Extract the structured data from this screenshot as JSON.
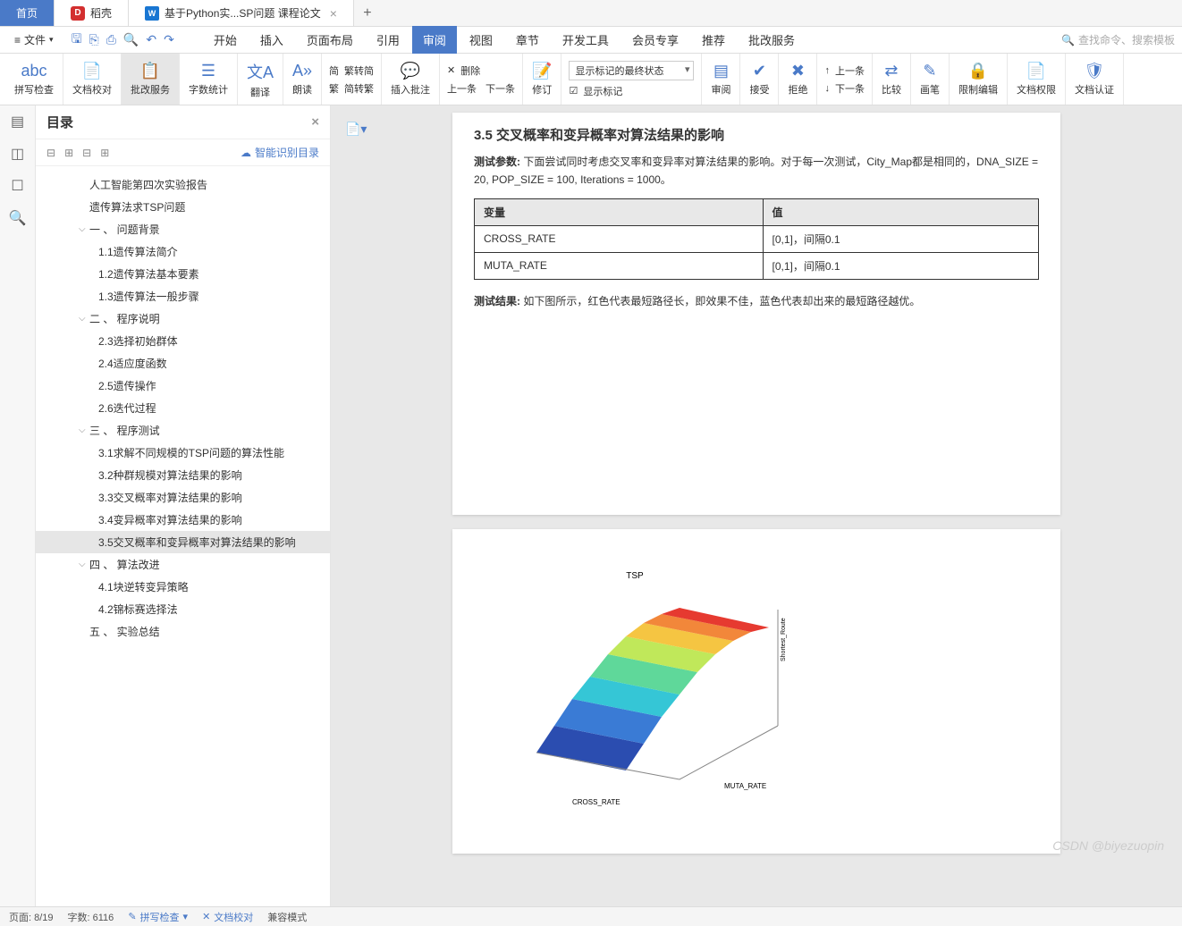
{
  "tabs": {
    "home": "首页",
    "dao": "稻壳",
    "doc": "基于Python实...SP问题 课程论文"
  },
  "menubar": {
    "file": "文件",
    "tabs": [
      "开始",
      "插入",
      "页面布局",
      "引用",
      "审阅",
      "视图",
      "章节",
      "开发工具",
      "会员专享",
      "推荐",
      "批改服务"
    ],
    "active_index": 4,
    "search_placeholder": "查找命令、搜索模板"
  },
  "ribbon": {
    "spell": "拼写检查",
    "doc_proof": "文档校对",
    "review_service": "批改服务",
    "word_count": "字数统计",
    "translate": "翻译",
    "read": "朗读",
    "fan": "繁转简",
    "jian": "简转繁",
    "fan_label": "繁",
    "jian_label": "简",
    "insert_comment": "插入批注",
    "delete": "删除",
    "prev": "上一条",
    "next": "下一条",
    "track": "修订",
    "show_select": "显示标记的最终状态",
    "show_marks": "显示标记",
    "review": "审阅",
    "accept": "接受",
    "reject": "拒绝",
    "prev2": "上一条",
    "next2": "下一条",
    "compare": "比较",
    "ink": "画笔",
    "limit_edit": "限制编辑",
    "doc_perm": "文档权限",
    "doc_cert": "文档认证"
  },
  "toc": {
    "title": "目录",
    "smart": "智能识别目录",
    "items": [
      {
        "text": "人工智能第四次实验报告",
        "lvl": 0
      },
      {
        "text": "遗传算法求TSP问题",
        "lvl": 0
      },
      {
        "text": "一 、 问题背景",
        "lvl": 1,
        "expand": true
      },
      {
        "text": "1.1遗传算法简介",
        "lvl": 2
      },
      {
        "text": "1.2遗传算法基本要素",
        "lvl": 2
      },
      {
        "text": "1.3遗传算法一般步骤",
        "lvl": 2
      },
      {
        "text": "二 、 程序说明",
        "lvl": 1,
        "expand": true
      },
      {
        "text": "2.3选择初始群体",
        "lvl": 2
      },
      {
        "text": "2.4适应度函数",
        "lvl": 2
      },
      {
        "text": "2.5遗传操作",
        "lvl": 2
      },
      {
        "text": "2.6迭代过程",
        "lvl": 2
      },
      {
        "text": "三 、 程序测试",
        "lvl": 1,
        "expand": true
      },
      {
        "text": "3.1求解不同规模的TSP问题的算法性能",
        "lvl": 2
      },
      {
        "text": "3.2种群规模对算法结果的影响",
        "lvl": 2
      },
      {
        "text": "3.3交叉概率对算法结果的影响",
        "lvl": 2
      },
      {
        "text": "3.4变异概率对算法结果的影响",
        "lvl": 2
      },
      {
        "text": "3.5交叉概率和变异概率对算法结果的影响",
        "lvl": 2,
        "selected": true
      },
      {
        "text": "四 、 算法改进",
        "lvl": 1,
        "expand": true
      },
      {
        "text": "4.1块逆转变异策略",
        "lvl": 2
      },
      {
        "text": "4.2锦标赛选择法",
        "lvl": 2
      },
      {
        "text": "五 、 实验总结",
        "lvl": 1
      }
    ]
  },
  "doc": {
    "section_title": "3.5 交叉概率和变异概率对算法结果的影响",
    "params_label": "测试参数:",
    "params_text": "下面尝试同时考虑交叉率和变异率对算法结果的影响。对于每一次测试，City_Map都是相同的，DNA_SIZE = 20, POP_SIZE = 100, Iterations = 1000。",
    "table": {
      "headers": [
        "变量",
        "值"
      ],
      "rows": [
        [
          "CROSS_RATE",
          "[0,1]，间隔0.1"
        ],
        [
          "MUTA_RATE",
          "[0,1]，间隔0.1"
        ]
      ]
    },
    "result_label": "测试结果:",
    "result_text": "如下图所示，红色代表最短路径长，即效果不佳，蓝色代表却出来的最短路径越优。"
  },
  "status": {
    "page": "页面: 8/19",
    "words": "字数: 6116",
    "spell": "拼写检查",
    "proof": "文档校对",
    "compat": "兼容模式"
  },
  "watermark": "CSDN @biyezuopin",
  "chart_data": {
    "type": "heatmap",
    "title": "TSP",
    "xlabel": "CROSS_RATE",
    "ylabel": "MUTA_RATE",
    "zlabel": "Shortest_Route",
    "x": [
      0.0,
      0.1,
      0.2,
      0.3,
      0.4,
      0.5,
      0.6,
      0.7,
      0.8,
      0.9,
      1.0
    ],
    "y": [
      0.0,
      0.1,
      0.2,
      0.3,
      0.4,
      0.5,
      0.6,
      0.7,
      0.8,
      0.9,
      1.0
    ],
    "zlim": [
      400,
      1000
    ],
    "note": "3D surface; red = longer path, blue = shorter path"
  }
}
